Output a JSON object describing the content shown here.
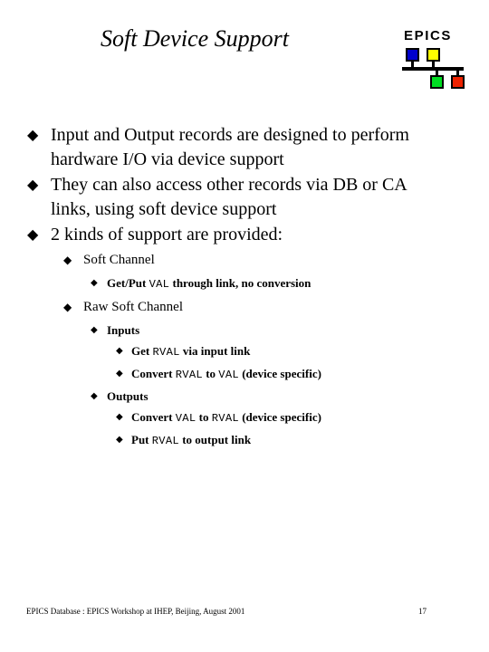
{
  "slide": {
    "title": "Soft Device Support"
  },
  "logo": {
    "wordmark": "EPICS",
    "colors": {
      "node_blue": "#0000CC",
      "node_yellow": "#FFFF00",
      "node_green": "#00DD22",
      "node_red": "#EE2200",
      "outline": "#000000"
    }
  },
  "bullet_glyphs": {
    "level1": "◆",
    "level2": "◆",
    "level3": "◆",
    "level4": "◆"
  },
  "outline": [
    {
      "level": 1,
      "text": "Input and Output records are designed to perform hardware I/O via device support"
    },
    {
      "level": 1,
      "text": "They can also access other records via DB or CA links, using soft device support"
    },
    {
      "level": 1,
      "text": "2 kinds of support are provided:"
    },
    {
      "level": 2,
      "text": "Soft Channel"
    },
    {
      "level": 3,
      "parts": [
        {
          "t": "Get/Put ",
          "mono": false
        },
        {
          "t": "VAL",
          "mono": true
        },
        {
          "t": " through link, no conversion",
          "mono": false
        }
      ],
      "text": "Get/Put VAL through link, no conversion"
    },
    {
      "level": 2,
      "text": "Raw Soft Channel"
    },
    {
      "level": 3,
      "text": "Inputs"
    },
    {
      "level": 4,
      "parts": [
        {
          "t": "Get ",
          "mono": false
        },
        {
          "t": "RVAL",
          "mono": true
        },
        {
          "t": " via input link",
          "mono": false
        }
      ],
      "text": "Get RVAL via input link"
    },
    {
      "level": 4,
      "parts": [
        {
          "t": "Convert ",
          "mono": false
        },
        {
          "t": "RVAL",
          "mono": true
        },
        {
          "t": " to ",
          "mono": false
        },
        {
          "t": "VAL",
          "mono": true
        },
        {
          "t": " (device specific)",
          "mono": false
        }
      ],
      "text": "Convert RVAL to VAL (device specific)"
    },
    {
      "level": 3,
      "text": "Outputs"
    },
    {
      "level": 4,
      "parts": [
        {
          "t": "Convert ",
          "mono": false
        },
        {
          "t": "VAL",
          "mono": true
        },
        {
          "t": " to ",
          "mono": false
        },
        {
          "t": "RVAL",
          "mono": true
        },
        {
          "t": " (device specific)",
          "mono": false
        }
      ],
      "text": "Convert VAL to RVAL (device specific)"
    },
    {
      "level": 4,
      "parts": [
        {
          "t": "Put ",
          "mono": false
        },
        {
          "t": "RVAL",
          "mono": true
        },
        {
          "t": " to output link",
          "mono": false
        }
      ],
      "text": "Put RVAL to output link"
    }
  ],
  "footer": {
    "text": "EPICS Database : EPICS Workshop at IHEP, Beijing, August 2001",
    "page_number": "17"
  }
}
